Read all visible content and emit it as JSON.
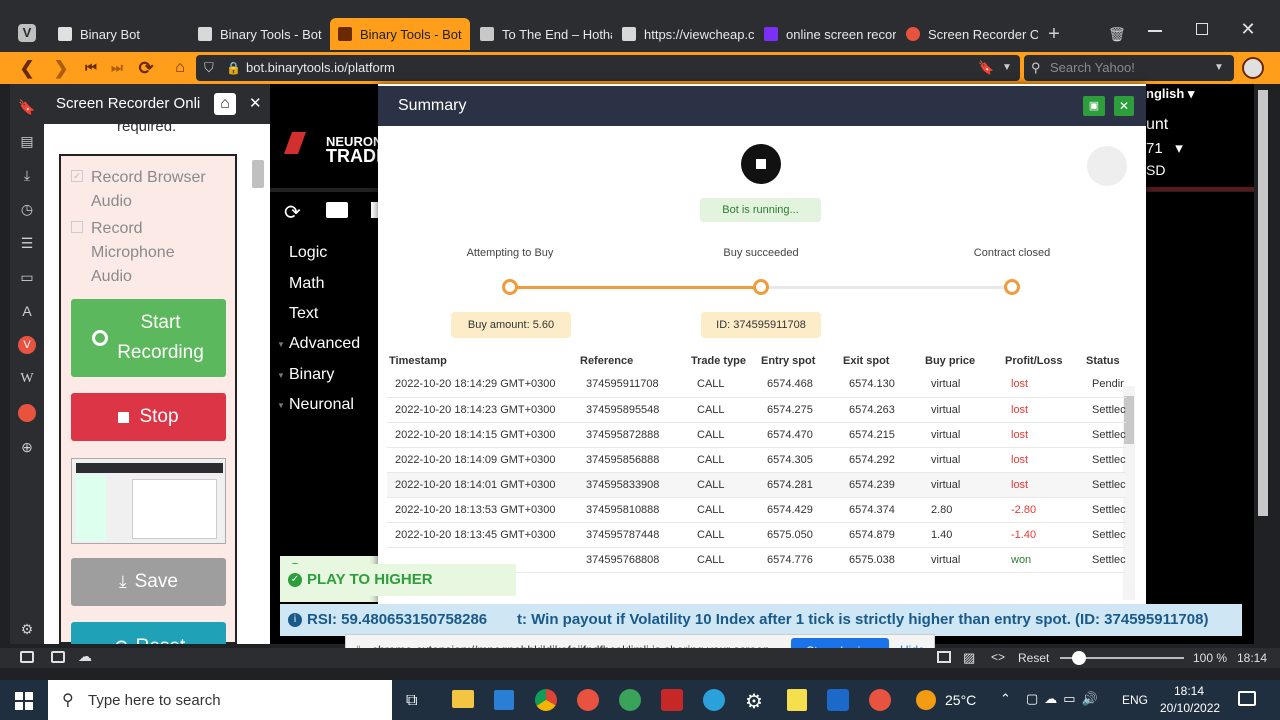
{
  "tabs": [
    {
      "title": "Binary Bot",
      "color": "#e8e8e8"
    },
    {
      "title": "Binary Tools - Bot",
      "color": "#e8e8e8"
    },
    {
      "title": "Binary Tools - Bot",
      "color": "#ff9e1b"
    },
    {
      "title": "To The End – Hothar",
      "color": "#e8e8e8"
    },
    {
      "title": "https://viewcheap.cc",
      "color": "#e8e8e8"
    },
    {
      "title": "online screen record",
      "color": "#7b2ff7"
    },
    {
      "title": "Screen Recorder Onl",
      "color": "#e8533f"
    }
  ],
  "address": {
    "url": "bot.binarytools.io/platform",
    "search_placeholder": "Search Yahoo!"
  },
  "recorder": {
    "title": "Screen Recorder Onli",
    "required_text": "required.",
    "record_browser_audio": "Record Browser Audio",
    "record_mic_audio": "Record Microphone Audio",
    "start_label": "Start Recording",
    "stop_label": "Stop",
    "save_label": "Save",
    "reset_label": "Reset"
  },
  "bot": {
    "brand1": "NEURON",
    "brand2": "TRADE",
    "lang": "nglish",
    "account1": "unt",
    "account2": "71",
    "account3": "SD",
    "menu": [
      "Logic",
      "Math",
      "Text",
      "Advanced",
      "Binary",
      "Neuronal"
    ],
    "notif_play": "PLAY TO HIGHER",
    "notif_rsi": "RSI: 59.480653150758286",
    "notif_contract": "t: Win payout if Volatility 10 Index after 1 tick is strictly higher than entry spot. (ID: 374595911708)"
  },
  "summary": {
    "title": "Summary",
    "status": "Bot is running...",
    "steps": [
      "Attempting to Buy",
      "Buy succeeded",
      "Contract closed"
    ],
    "buy_amount": "Buy amount: 5.60",
    "contract_id": "ID: 374595911708",
    "columns": [
      "Timestamp",
      "Reference",
      "Trade type",
      "Entry spot",
      "Exit spot",
      "Buy price",
      "Profit/Loss",
      "Status"
    ],
    "rows": [
      [
        "2022-10-20 18:14:29 GMT+0300",
        "374595911708",
        "CALL",
        "6574.468",
        "6574.130",
        "virtual",
        "lost",
        "Pendir"
      ],
      [
        "2022-10-20 18:14:23 GMT+0300",
        "374595895548",
        "CALL",
        "6574.275",
        "6574.263",
        "virtual",
        "lost",
        "Settlec"
      ],
      [
        "2022-10-20 18:14:15 GMT+0300",
        "374595872888",
        "CALL",
        "6574.470",
        "6574.215",
        "virtual",
        "lost",
        "Settlec"
      ],
      [
        "2022-10-20 18:14:09 GMT+0300",
        "374595856888",
        "CALL",
        "6574.305",
        "6574.292",
        "virtual",
        "lost",
        "Settlec"
      ],
      [
        "2022-10-20 18:14:01 GMT+0300",
        "374595833908",
        "CALL",
        "6574.281",
        "6574.239",
        "virtual",
        "lost",
        "Settlec"
      ],
      [
        "2022-10-20 18:13:53 GMT+0300",
        "374595810888",
        "CALL",
        "6574.429",
        "6574.374",
        "2.80",
        "-2.80",
        "Settlec"
      ],
      [
        "2022-10-20 18:13:45 GMT+0300",
        "374595787448",
        "CALL",
        "6575.050",
        "6574.879",
        "1.40",
        "-1.40",
        "Settlec"
      ],
      [
        "",
        "374595768808",
        "CALL",
        "6574.776",
        "6575.038",
        "virtual",
        "won",
        "Settlec"
      ]
    ]
  },
  "sharing": {
    "text": "chrome-extension://mpognobbkildjkofajifpdfhcoklimli is sharing your screen.",
    "stop": "Stop sharing",
    "hide": "Hide"
  },
  "statusbar": {
    "reset": "Reset",
    "zoom": "100 %",
    "time": "18:14"
  },
  "taskbar": {
    "search": "Type here to search",
    "weather": "25°C",
    "lang": "ENG",
    "time": "18:14",
    "date": "20/10/2022"
  }
}
